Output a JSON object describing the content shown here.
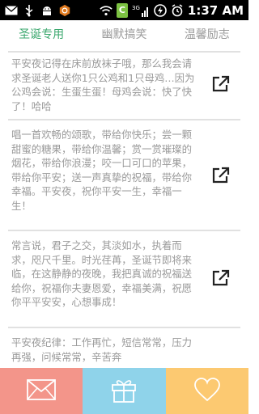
{
  "status": {
    "time": "1:37 AM",
    "carrier_badge": "C",
    "network_label": "3G"
  },
  "tabs": [
    {
      "label": "圣诞专用",
      "active": true
    },
    {
      "label": "幽默搞笑",
      "active": false
    },
    {
      "label": "温馨励志",
      "active": false
    }
  ],
  "messages": [
    {
      "text": "平安夜记得在床前放袜子哦，那么我会请求圣诞老人送你1只公鸡和1只母鸡…因为公鸡会说：生蛋生蛋！母鸡会说：快了快了！哈哈"
    },
    {
      "text": "唱一首欢畅的颂歌，带给你快乐；尝一颗甜蜜的糖果，带给你温馨；赏一赏璀璨的烟花，带给你浪漫；咬一口可口的苹果，带给你平安；送一声真挚的祝福，带给你幸福。平安夜，祝你平安一生，幸福一生！"
    },
    {
      "text": "常言说，君子之交，其淡如水，执着而求，咫尺千里。时光荏苒，圣诞节即将来临，在这静静的夜晚，我把真诚的祝福送给你，祝福你夫妻恩爱，幸福美满，祝愿你平平安安，心想事成！"
    },
    {
      "text": "平安夜纪律：工作再忙，短信常常，压力再强，问候常常，辛苦奔"
    }
  ],
  "icons": {
    "share": "share-out-icon",
    "mail": "mail-icon",
    "gift": "gift-icon",
    "heart": "heart-icon"
  },
  "colors": {
    "accent": "#3aa76d",
    "mail_bg": "#f3958a",
    "gift_bg": "#8fd3ea",
    "heart_bg": "#fcc971"
  }
}
